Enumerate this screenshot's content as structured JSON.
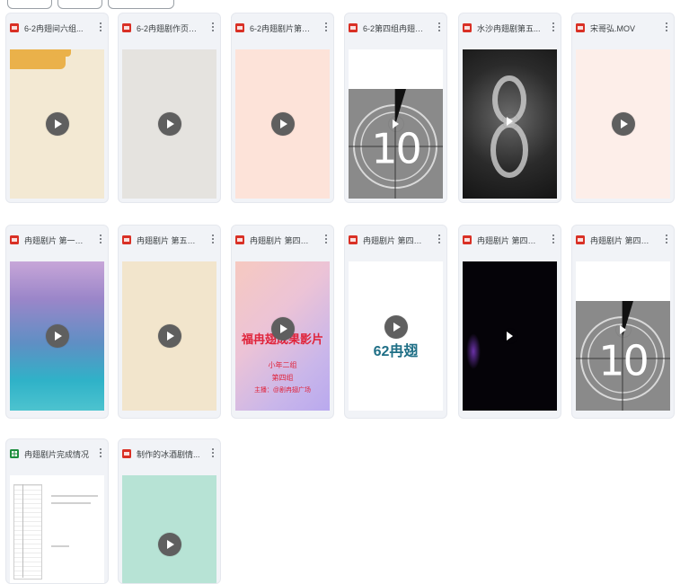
{
  "top_chips": [
    {
      "name": "filter-chip-1"
    },
    {
      "name": "filter-chip-2"
    },
    {
      "name": "filter-chip-3"
    }
  ],
  "files": [
    {
      "title": "6-2冉翅间六组...",
      "type": "video",
      "thumb": "beige-folder"
    },
    {
      "title": "6-2冉翅剧作页一...",
      "type": "video",
      "thumb": "gray"
    },
    {
      "title": "6-2冉翅剧片第二...",
      "type": "video",
      "thumb": "peach"
    },
    {
      "title": "6-2第四组冉翅剧...",
      "type": "video",
      "thumb": "countdown"
    },
    {
      "title": "水沙冉翅剧第五...",
      "type": "video",
      "thumb": "dark-rain"
    },
    {
      "title": "宋哥弘.MOV",
      "type": "video",
      "thumb": "blush"
    },
    {
      "title": "冉翅剧片 第一组...",
      "type": "video",
      "thumb": "sea"
    },
    {
      "title": "冉翅剧片 第五组(...",
      "type": "video",
      "thumb": "sand"
    },
    {
      "title": "冉翅剧片 第四组(...",
      "type": "video",
      "thumb": "poster"
    },
    {
      "title": "冉翅剧片 第四组(...",
      "type": "video",
      "thumb": "white-62"
    },
    {
      "title": "冉翅剧片 第四组...",
      "type": "video",
      "thumb": "black"
    },
    {
      "title": "冉翅剧片 第四组(...",
      "type": "video",
      "thumb": "countdown"
    },
    {
      "title": "冉翅剧片完成情况",
      "type": "sheet",
      "thumb": "sheet"
    },
    {
      "title": "制作的冰酒剧情...",
      "type": "video",
      "thumb": "mint"
    }
  ],
  "thumb_text": {
    "countdown": "10",
    "poster_title": "福冉翅成果影片",
    "poster_line1": "小年二组",
    "poster_line2": "第四组",
    "poster_line3": "主播：@剧冉翅广场",
    "white62": "62冉翅"
  },
  "colors": {
    "video_icon": "#d93025",
    "sheet_icon": "#1e8e3e",
    "card_bg": "#f1f3f7"
  }
}
